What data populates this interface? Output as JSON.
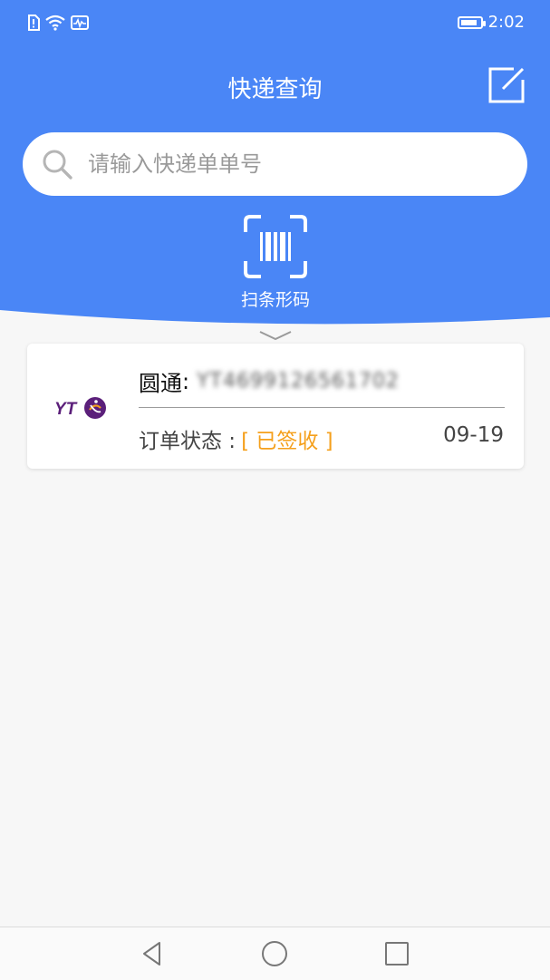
{
  "status_bar": {
    "time": "2:02",
    "battery_level": 0.85
  },
  "header": {
    "title": "快递查询"
  },
  "search": {
    "placeholder": "请输入快递单单号"
  },
  "scan": {
    "label": "扫条形码"
  },
  "records": [
    {
      "courier": "圆通",
      "separator": " :",
      "tracking_number": "YT4699126561702",
      "status_label": "订单状态 :",
      "status_value": "[ 已签收 ]",
      "date": "09-19",
      "logo_text": "YT"
    }
  ],
  "colors": {
    "primary": "#4a86f6",
    "status": "#f5a01c",
    "logo": "#5b1f7a"
  }
}
